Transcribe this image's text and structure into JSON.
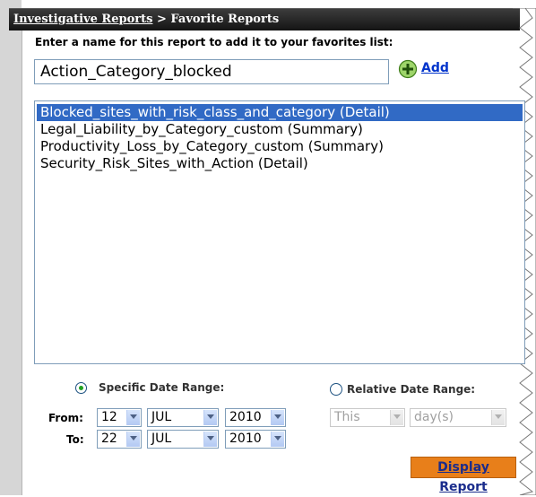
{
  "breadcrumb": {
    "parent": "Investigative Reports",
    "separator": " > ",
    "current": "Favorite Reports"
  },
  "favorites": {
    "prompt": "Enter a name for this report to add it to your favorites list:",
    "name_value": "Action_Category_blocked",
    "add_label": "Add"
  },
  "report_list": [
    {
      "label": "Blocked_sites_with_risk_class_and_category (Detail)",
      "selected": true
    },
    {
      "label": "Legal_Liability_by_Category_custom (Summary)",
      "selected": false
    },
    {
      "label": "Productivity_Loss_by_Category_custom (Summary)",
      "selected": false
    },
    {
      "label": "Security_Risk_Sites_with_Action (Detail)",
      "selected": false
    }
  ],
  "date_range": {
    "specific_label": "Specific Date Range:",
    "specific_selected": true,
    "from_label": "From:",
    "to_label": "To:",
    "from": {
      "day": "12",
      "month": "JUL",
      "year": "2010"
    },
    "to": {
      "day": "22",
      "month": "JUL",
      "year": "2010"
    },
    "relative_label": "Relative Date Range:",
    "relative_selected": false,
    "relative_period": "This",
    "relative_unit": "day(s)"
  },
  "actions": {
    "display_report_label": "Display Report"
  },
  "colors": {
    "title_bar": "#141414",
    "selection": "#316ac5",
    "link": "#0033cc",
    "button": "#e87f1a",
    "radio_selected": "#21a121"
  }
}
